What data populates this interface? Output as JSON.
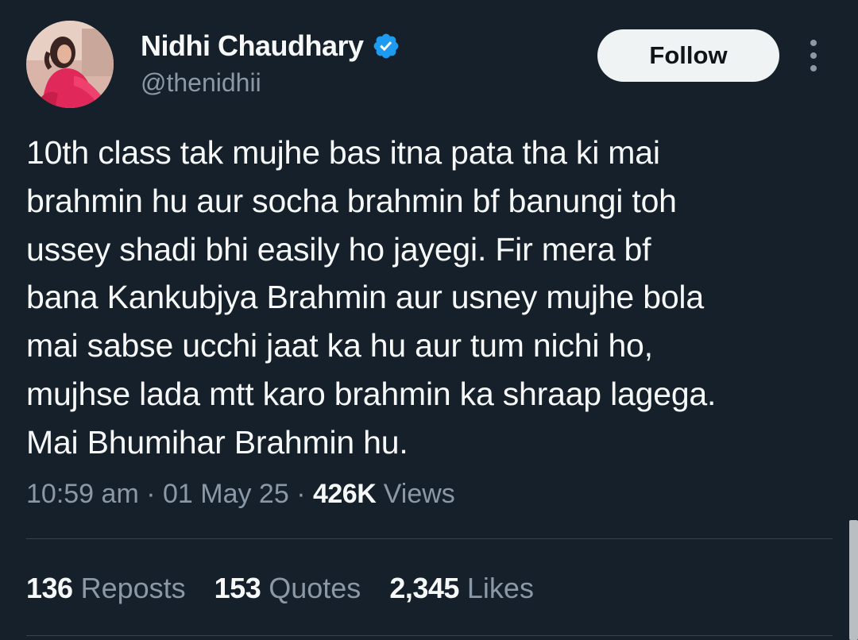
{
  "author": {
    "display_name": "Nidhi Chaudhary",
    "handle": "@thenidhii",
    "avatar_icon": "profile-photo",
    "verified_icon": "verified-badge-icon",
    "verified_color": "#1d9bf0"
  },
  "actions": {
    "follow_label": "Follow",
    "more_icon": "more-vertical-icon"
  },
  "tweet": {
    "lines": [
      "10th class tak mujhe bas itna pata tha ki mai",
      "brahmin hu aur socha brahmin bf banungi toh",
      "ussey shadi bhi easily ho jayegi. Fir mera bf",
      "bana Kankubjya Brahmin aur usney mujhe bola",
      "mai sabse ucchi jaat ka hu aur tum nichi ho,",
      "mujhse lada mtt karo brahmin ka shraap lagega.",
      "Mai Bhumihar Brahmin hu."
    ]
  },
  "meta": {
    "time": "10:59 am",
    "separator": " · ",
    "date": "01 May 25",
    "views_count": "426K",
    "views_label": "Views"
  },
  "stats": {
    "reposts_count": "136",
    "reposts_label": "Reposts",
    "quotes_count": "153",
    "quotes_label": "Quotes",
    "likes_count": "2,345",
    "likes_label": "Likes"
  },
  "colors": {
    "background": "#15202b",
    "text_primary": "#f7f9f9",
    "text_secondary": "#8b98a5",
    "divider": "#38444d",
    "follow_bg": "#eff3f4"
  }
}
